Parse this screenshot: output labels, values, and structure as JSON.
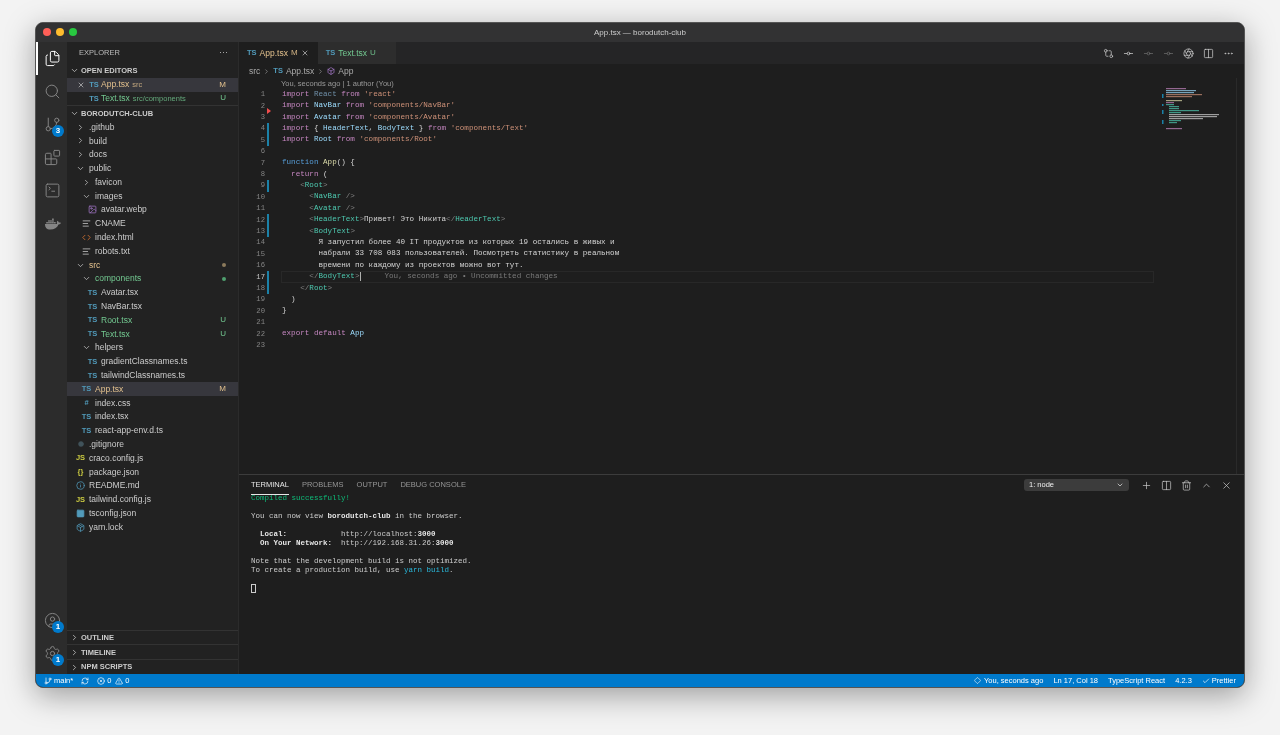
{
  "window": {
    "title": "App.tsx — borodutch-club"
  },
  "activity_bar": {
    "top": [
      {
        "kind": "files",
        "selected": true
      },
      {
        "kind": "search",
        "selected": false
      },
      {
        "kind": "scm",
        "selected": false,
        "badge": "3"
      },
      {
        "kind": "extensions",
        "selected": false
      },
      {
        "kind": "terminal",
        "selected": false
      },
      {
        "kind": "docker",
        "selected": false
      }
    ],
    "bottom": [
      {
        "kind": "account",
        "badge": "1"
      },
      {
        "kind": "settings",
        "badge": "1"
      }
    ]
  },
  "sidebar": {
    "title": "EXPLORER",
    "more": "···",
    "open_editors": {
      "title": "OPEN EDITORS",
      "expanded": true,
      "items": [
        {
          "name": "App.tsx",
          "glyph": "TS",
          "kind": "ts",
          "description": "src",
          "badge": "M",
          "modified": true,
          "untracked": false,
          "selected": true
        },
        {
          "name": "Text.tsx",
          "glyph": "TS",
          "kind": "ts",
          "description": "src/components",
          "badge": "U",
          "modified": false,
          "untracked": true,
          "selected": false
        }
      ]
    },
    "project": {
      "title": "BORODUTCH-CLUB",
      "expanded": true,
      "items": [
        {
          "name": ".github",
          "kind": "folder",
          "expanded": false,
          "modified": false,
          "untracked": false,
          "selected": false
        },
        {
          "name": "build",
          "kind": "folder",
          "expanded": false,
          "modified": false,
          "untracked": false,
          "selected": false
        },
        {
          "name": "docs",
          "kind": "folder",
          "expanded": false,
          "modified": false,
          "untracked": false,
          "selected": false
        },
        {
          "name": "public",
          "kind": "folder",
          "expanded": true,
          "modified": false,
          "untracked": false,
          "selected": false,
          "children": [
            {
              "name": "favicon",
              "kind": "folder",
              "expanded": false,
              "modified": false,
              "untracked": false,
              "selected": false
            },
            {
              "name": "images",
              "kind": "folder",
              "expanded": true,
              "modified": false,
              "untracked": false,
              "selected": false,
              "children": [
                {
                  "name": "avatar.webp",
                  "kind": "image",
                  "modified": false,
                  "untracked": false,
                  "selected": false
                }
              ]
            },
            {
              "name": "CNAME",
              "kind": "text",
              "modified": false,
              "untracked": false,
              "selected": false
            },
            {
              "name": "index.html",
              "kind": "html",
              "modified": false,
              "untracked": false,
              "selected": false
            },
            {
              "name": "robots.txt",
              "kind": "text",
              "modified": false,
              "untracked": false,
              "selected": false
            }
          ]
        },
        {
          "name": "src",
          "kind": "folder",
          "expanded": true,
          "modified": true,
          "untracked": false,
          "selected": false,
          "children": [
            {
              "name": "components",
              "kind": "folder",
              "expanded": true,
              "modified": false,
              "untracked": true,
              "selected": false,
              "children": [
                {
                  "name": "Avatar.tsx",
                  "kind": "ts",
                  "glyph": "TS",
                  "modified": false,
                  "untracked": false,
                  "selected": false
                },
                {
                  "name": "NavBar.tsx",
                  "kind": "ts",
                  "glyph": "TS",
                  "modified": false,
                  "untracked": false,
                  "selected": false
                },
                {
                  "name": "Root.tsx",
                  "kind": "ts",
                  "glyph": "TS",
                  "modified": false,
                  "untracked": true,
                  "badge": "U",
                  "selected": false
                },
                {
                  "name": "Text.tsx",
                  "kind": "ts",
                  "glyph": "TS",
                  "modified": false,
                  "untracked": true,
                  "badge": "U",
                  "selected": false
                }
              ]
            },
            {
              "name": "helpers",
              "kind": "folder",
              "expanded": true,
              "modified": false,
              "untracked": false,
              "selected": false,
              "children": [
                {
                  "name": "gradientClassnames.ts",
                  "kind": "ts",
                  "glyph": "TS",
                  "modified": false,
                  "untracked": false,
                  "selected": false
                },
                {
                  "name": "tailwindClassnames.ts",
                  "kind": "ts",
                  "glyph": "TS",
                  "modified": false,
                  "untracked": false,
                  "selected": false
                }
              ]
            },
            {
              "name": "App.tsx",
              "kind": "ts",
              "glyph": "TS",
              "modified": true,
              "untracked": false,
              "badge": "M",
              "selected": true
            },
            {
              "name": "index.css",
              "kind": "css",
              "glyph": "#",
              "modified": false,
              "untracked": false,
              "selected": false
            },
            {
              "name": "index.tsx",
              "kind": "ts",
              "glyph": "TS",
              "modified": false,
              "untracked": false,
              "selected": false
            },
            {
              "name": "react-app-env.d.ts",
              "kind": "ts",
              "glyph": "TS",
              "modified": false,
              "untracked": false,
              "selected": false
            }
          ]
        },
        {
          "name": ".gitignore",
          "kind": "ignore",
          "modified": false,
          "untracked": false,
          "selected": false
        },
        {
          "name": "craco.config.js",
          "kind": "js",
          "glyph": "JS",
          "modified": false,
          "untracked": false,
          "selected": false
        },
        {
          "name": "package.json",
          "kind": "json",
          "glyph": "{}",
          "modified": false,
          "untracked": false,
          "selected": false
        },
        {
          "name": "README.md",
          "kind": "info",
          "modified": false,
          "untracked": false,
          "selected": false
        },
        {
          "name": "tailwind.config.js",
          "kind": "js",
          "glyph": "JS",
          "modified": false,
          "untracked": false,
          "selected": false
        },
        {
          "name": "tsconfig.json",
          "kind": "config",
          "modified": false,
          "untracked": false,
          "selected": false
        },
        {
          "name": "yarn.lock",
          "kind": "lock",
          "modified": false,
          "untracked": false,
          "selected": false
        }
      ]
    },
    "sections": [
      {
        "title": "OUTLINE",
        "expanded": false
      },
      {
        "title": "TIMELINE",
        "expanded": false
      },
      {
        "title": "NPM SCRIPTS",
        "expanded": false
      }
    ]
  },
  "tabs": [
    {
      "name": "App.tsx",
      "glyph": "TS",
      "badge": "M",
      "modified": true,
      "untracked": false,
      "selected": true
    },
    {
      "name": "Text.tsx",
      "glyph": "TS",
      "badge": "U",
      "modified": false,
      "untracked": true,
      "selected": false
    }
  ],
  "editor_actions": [
    {
      "kind": "compare",
      "disabled": false
    },
    {
      "kind": "commit",
      "disabled": false
    },
    {
      "kind": "commit",
      "disabled": true
    },
    {
      "kind": "commit",
      "disabled": true
    },
    {
      "kind": "circle",
      "disabled": false
    },
    {
      "kind": "split",
      "disabled": false
    },
    {
      "kind": "more",
      "disabled": false
    }
  ],
  "breadcrumb": [
    {
      "kind": "folder",
      "text": "src"
    },
    {
      "kind": "ts",
      "glyph": "TS",
      "text": "App.tsx"
    },
    {
      "kind": "symbol",
      "text": "App"
    }
  ],
  "codelens": "You, seconds ago | 1 author (You)",
  "lines": [
    {
      "number": "1",
      "changed": false,
      "deleted": false,
      "current": false,
      "tokens": [
        {
          "kind": "kw",
          "text": "import "
        },
        {
          "kind": "dim",
          "text": "React"
        },
        {
          "kind": "kw",
          "text": " from "
        },
        {
          "kind": "str",
          "text": "'react'"
        }
      ]
    },
    {
      "number": "2",
      "changed": false,
      "deleted": true,
      "current": false,
      "tokens": [
        {
          "kind": "kw",
          "text": "import "
        },
        {
          "kind": "ident",
          "text": "NavBar"
        },
        {
          "kind": "kw",
          "text": " from "
        },
        {
          "kind": "str",
          "text": "'components/NavBar'"
        }
      ]
    },
    {
      "number": "3",
      "changed": false,
      "deleted": false,
      "current": false,
      "tokens": [
        {
          "kind": "kw",
          "text": "import "
        },
        {
          "kind": "ident",
          "text": "Avatar"
        },
        {
          "kind": "kw",
          "text": " from "
        },
        {
          "kind": "str",
          "text": "'components/Avatar'"
        }
      ]
    },
    {
      "number": "4",
      "changed": true,
      "deleted": false,
      "current": false,
      "tokens": [
        {
          "kind": "kw",
          "text": "import "
        },
        {
          "kind": "text",
          "text": "{ "
        },
        {
          "kind": "ident",
          "text": "HeaderText"
        },
        {
          "kind": "text",
          "text": ", "
        },
        {
          "kind": "ident",
          "text": "BodyText"
        },
        {
          "kind": "text",
          "text": " } "
        },
        {
          "kind": "kw",
          "text": "from "
        },
        {
          "kind": "str",
          "text": "'components/Text'"
        }
      ]
    },
    {
      "number": "5",
      "changed": true,
      "deleted": false,
      "current": false,
      "tokens": [
        {
          "kind": "kw",
          "text": "import "
        },
        {
          "kind": "ident",
          "text": "Root"
        },
        {
          "kind": "kw",
          "text": " from "
        },
        {
          "kind": "str",
          "text": "'components/Root'"
        }
      ]
    },
    {
      "number": "6",
      "changed": false,
      "deleted": false,
      "current": false
    },
    {
      "number": "7",
      "changed": false,
      "deleted": false,
      "current": false,
      "tokens": [
        {
          "kind": "storage",
          "text": "function "
        },
        {
          "kind": "func",
          "text": "App"
        },
        {
          "kind": "text",
          "text": "() {"
        }
      ]
    },
    {
      "number": "8",
      "changed": false,
      "deleted": false,
      "current": false,
      "tokens": [
        {
          "kind": "kw",
          "text": "  return"
        },
        {
          "kind": "text",
          "text": " ("
        }
      ]
    },
    {
      "number": "9",
      "changed": true,
      "deleted": false,
      "current": false,
      "tokens": [
        {
          "kind": "punct",
          "text": "    <"
        },
        {
          "kind": "tag",
          "text": "Root"
        },
        {
          "kind": "punct",
          "text": ">"
        }
      ]
    },
    {
      "number": "10",
      "changed": false,
      "deleted": false,
      "current": false,
      "tokens": [
        {
          "kind": "punct",
          "text": "      <"
        },
        {
          "kind": "tag",
          "text": "NavBar"
        },
        {
          "kind": "punct",
          "text": " />"
        }
      ]
    },
    {
      "number": "11",
      "changed": false,
      "deleted": false,
      "current": false,
      "tokens": [
        {
          "kind": "punct",
          "text": "      <"
        },
        {
          "kind": "tag",
          "text": "Avatar"
        },
        {
          "kind": "punct",
          "text": " />"
        }
      ]
    },
    {
      "number": "12",
      "changed": true,
      "deleted": false,
      "current": false,
      "tokens": [
        {
          "kind": "punct",
          "text": "      <"
        },
        {
          "kind": "tag",
          "text": "HeaderText"
        },
        {
          "kind": "punct",
          "text": ">"
        },
        {
          "kind": "text",
          "text": "Привет! Это Никита"
        },
        {
          "kind": "punct",
          "text": "</"
        },
        {
          "kind": "tag",
          "text": "HeaderText"
        },
        {
          "kind": "punct",
          "text": ">"
        }
      ]
    },
    {
      "number": "13",
      "changed": true,
      "deleted": false,
      "current": false,
      "tokens": [
        {
          "kind": "punct",
          "text": "      <"
        },
        {
          "kind": "tag",
          "text": "BodyText"
        },
        {
          "kind": "punct",
          "text": ">"
        }
      ]
    },
    {
      "number": "14",
      "changed": false,
      "deleted": false,
      "current": false,
      "tokens": [
        {
          "kind": "text",
          "text": "        Я запустил более 40 IT продуктов из которых 19 остались в живых и"
        }
      ]
    },
    {
      "number": "15",
      "changed": false,
      "deleted": false,
      "current": false,
      "tokens": [
        {
          "kind": "text",
          "text": "        набрали 33 708 083 пользователей. Посмотреть статистику в реальном"
        }
      ]
    },
    {
      "number": "16",
      "changed": false,
      "deleted": false,
      "current": false,
      "tokens": [
        {
          "kind": "text",
          "text": "        времени по каждому из проектов можно вот тут."
        }
      ]
    },
    {
      "number": "17",
      "changed": true,
      "deleted": false,
      "current": true,
      "blame": "You, seconds ago • Uncommitted changes",
      "tokens": [
        {
          "kind": "punct",
          "text": "      </"
        },
        {
          "kind": "tag",
          "text": "BodyText"
        },
        {
          "kind": "punct",
          "text": ">"
        }
      ]
    },
    {
      "number": "18",
      "changed": true,
      "deleted": false,
      "current": false,
      "tokens": [
        {
          "kind": "punct",
          "text": "    </"
        },
        {
          "kind": "tag",
          "text": "Root"
        },
        {
          "kind": "punct",
          "text": ">"
        }
      ]
    },
    {
      "number": "19",
      "changed": false,
      "deleted": false,
      "current": false,
      "tokens": [
        {
          "kind": "text",
          "text": "  )"
        }
      ]
    },
    {
      "number": "20",
      "changed": false,
      "deleted": false,
      "current": false,
      "tokens": [
        {
          "kind": "text",
          "text": "}"
        }
      ]
    },
    {
      "number": "21",
      "changed": false,
      "deleted": false,
      "current": false
    },
    {
      "number": "22",
      "changed": false,
      "deleted": false,
      "current": false,
      "tokens": [
        {
          "kind": "kw",
          "text": "export default "
        },
        {
          "kind": "ident",
          "text": "App"
        }
      ]
    },
    {
      "number": "23",
      "changed": false,
      "deleted": false,
      "current": false
    }
  ],
  "panel": {
    "tabs": [
      {
        "label": "TERMINAL",
        "selected": true
      },
      {
        "label": "PROBLEMS",
        "selected": false
      },
      {
        "label": "OUTPUT",
        "selected": false
      },
      {
        "label": "DEBUG CONSOLE",
        "selected": false
      }
    ],
    "terminal_select": "1: node",
    "actions": [
      {
        "kind": "add"
      },
      {
        "kind": "split"
      },
      {
        "kind": "trash"
      },
      {
        "kind": "maximize"
      },
      {
        "kind": "close"
      }
    ],
    "blocks": [
      [
        [
          {
            "kind": "success",
            "text": "Compiled successfully!"
          }
        ]
      ],
      [
        [
          {
            "kind": "plain",
            "text": "You can now view "
          },
          {
            "kind": "bold",
            "text": "borodutch-club"
          },
          {
            "kind": "plain",
            "text": " in the browser."
          }
        ]
      ],
      [
        [
          {
            "kind": "bold",
            "text": "  Local:"
          },
          {
            "kind": "plain",
            "text": "            http://localhost:"
          },
          {
            "kind": "bold",
            "text": "3000"
          }
        ],
        [
          {
            "kind": "bold",
            "text": "  On Your Network:"
          },
          {
            "kind": "plain",
            "text": "  http://192.168.31.26:"
          },
          {
            "kind": "bold",
            "text": "3000"
          }
        ]
      ],
      [
        [
          {
            "kind": "plain",
            "text": "Note that the development build is not optimized."
          }
        ],
        [
          {
            "kind": "plain",
            "text": "To create a production build, use "
          },
          {
            "kind": "link",
            "text": "yarn build"
          },
          {
            "kind": "plain",
            "text": "."
          }
        ]
      ]
    ]
  },
  "status_bar": {
    "branch": "main*",
    "errors": "0",
    "warnings": "0",
    "blame": "You, seconds ago",
    "position": "Ln 17, Col 18",
    "language": "TypeScript React",
    "version": "4.2.3",
    "formatter": "Prettier"
  }
}
